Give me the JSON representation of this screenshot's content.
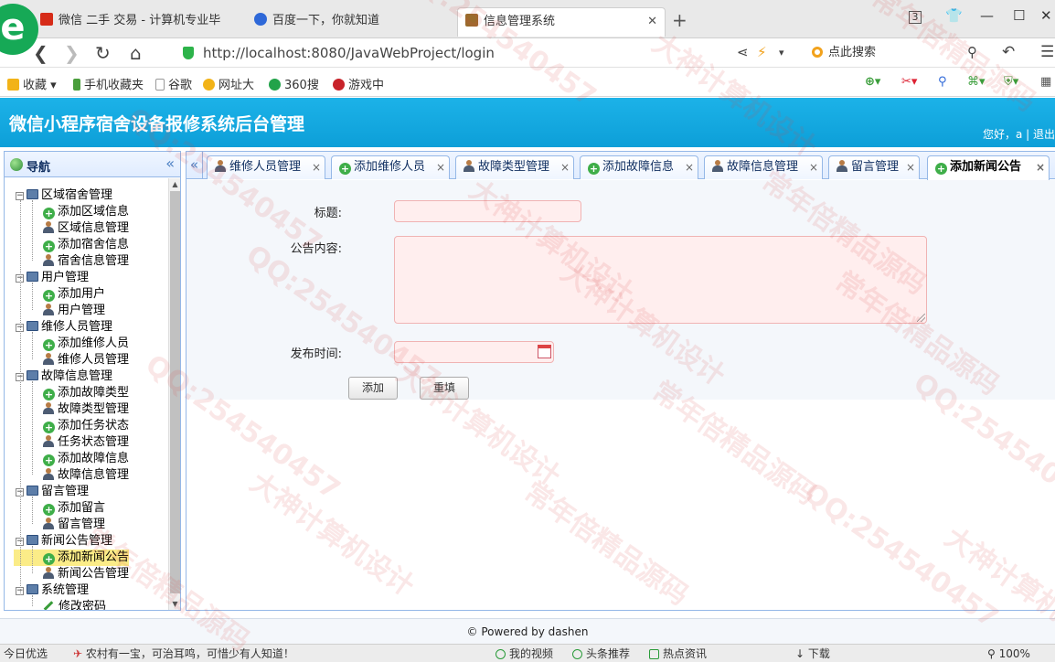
{
  "browser": {
    "tabs": [
      {
        "label": "微信 二手 交易 - 计算机专业毕",
        "fav_color": "#d62b18"
      },
      {
        "label": "百度一下，你就知道",
        "fav_color": "#2e68d8"
      },
      {
        "label": "信息管理系统",
        "fav_color": "#9a6b2c"
      }
    ],
    "new_tab": "+",
    "tab_count": "3",
    "url": "http://localhost:8080/JavaWebProject/login",
    "search_placeholder": "点此搜索"
  },
  "bookmarks": [
    {
      "label": "收藏",
      "color": "#f2b318"
    },
    {
      "label": "手机收藏夹",
      "color": "#4a9e3c"
    },
    {
      "label": "谷歌",
      "color": "#bbbbbb"
    },
    {
      "label": "网址大",
      "color": "#f2b318"
    },
    {
      "label": "360搜",
      "color": "#22a34a"
    },
    {
      "label": "游戏中",
      "color": "#c8232a"
    }
  ],
  "app": {
    "title": "微信小程序宿舍设备报修系统后台管理",
    "user_info": "您好，a | 退出"
  },
  "sidebar": {
    "title": "导航",
    "collapse_glyph": "«",
    "groups": [
      {
        "label": "区域宿舍管理",
        "items": [
          {
            "label": "添加区域信息",
            "icon": "add-icon"
          },
          {
            "label": "区域信息管理",
            "icon": "user-icon"
          },
          {
            "label": "添加宿舍信息",
            "icon": "add-icon"
          },
          {
            "label": "宿舍信息管理",
            "icon": "user-icon"
          }
        ]
      },
      {
        "label": "用户管理",
        "items": [
          {
            "label": "添加用户",
            "icon": "add-icon"
          },
          {
            "label": "用户管理",
            "icon": "user-icon"
          }
        ]
      },
      {
        "label": "维修人员管理",
        "items": [
          {
            "label": "添加维修人员",
            "icon": "add-icon"
          },
          {
            "label": "维修人员管理",
            "icon": "user-icon"
          }
        ]
      },
      {
        "label": "故障信息管理",
        "items": [
          {
            "label": "添加故障类型",
            "icon": "add-icon"
          },
          {
            "label": "故障类型管理",
            "icon": "user-icon"
          },
          {
            "label": "添加任务状态",
            "icon": "add-icon"
          },
          {
            "label": "任务状态管理",
            "icon": "user-icon"
          },
          {
            "label": "添加故障信息",
            "icon": "add-icon"
          },
          {
            "label": "故障信息管理",
            "icon": "user-icon"
          }
        ]
      },
      {
        "label": "留言管理",
        "items": [
          {
            "label": "添加留言",
            "icon": "add-icon"
          },
          {
            "label": "留言管理",
            "icon": "user-icon"
          }
        ]
      },
      {
        "label": "新闻公告管理",
        "items": [
          {
            "label": "添加新闻公告",
            "icon": "add-icon",
            "selected": true
          },
          {
            "label": "新闻公告管理",
            "icon": "user-icon"
          }
        ]
      },
      {
        "label": "系统管理",
        "items": [
          {
            "label": "修改密码",
            "icon": "pencil-icon"
          }
        ]
      }
    ]
  },
  "panel_tabs": [
    {
      "label": "维修人员管理",
      "icon": "user-icon"
    },
    {
      "label": "添加维修人员",
      "icon": "add-icon"
    },
    {
      "label": "故障类型管理",
      "icon": "user-icon"
    },
    {
      "label": "添加故障信息",
      "icon": "add-icon"
    },
    {
      "label": "故障信息管理",
      "icon": "user-icon"
    },
    {
      "label": "留言管理",
      "icon": "user-icon"
    },
    {
      "label": "添加新闻公告",
      "icon": "add-icon",
      "active": true
    }
  ],
  "form": {
    "title_label": "标题:",
    "title_value": "",
    "content_label": "公告内容:",
    "content_value": "",
    "date_label": "发布时间:",
    "date_value": "",
    "add_button": "添加",
    "reset_button": "重填"
  },
  "footer": "© Powered by dashen",
  "statusbar": {
    "left": "今日优选",
    "news": "农村有一宝，可治耳鸣，可惜少有人知道！",
    "video": "我的视频",
    "headline": "头条推荐",
    "hot": "热点资讯",
    "download": "下载",
    "zoom": "100%"
  },
  "watermarks": [
    "QQ:254540457",
    "大神计算机设计",
    "常年倍精品源码"
  ]
}
